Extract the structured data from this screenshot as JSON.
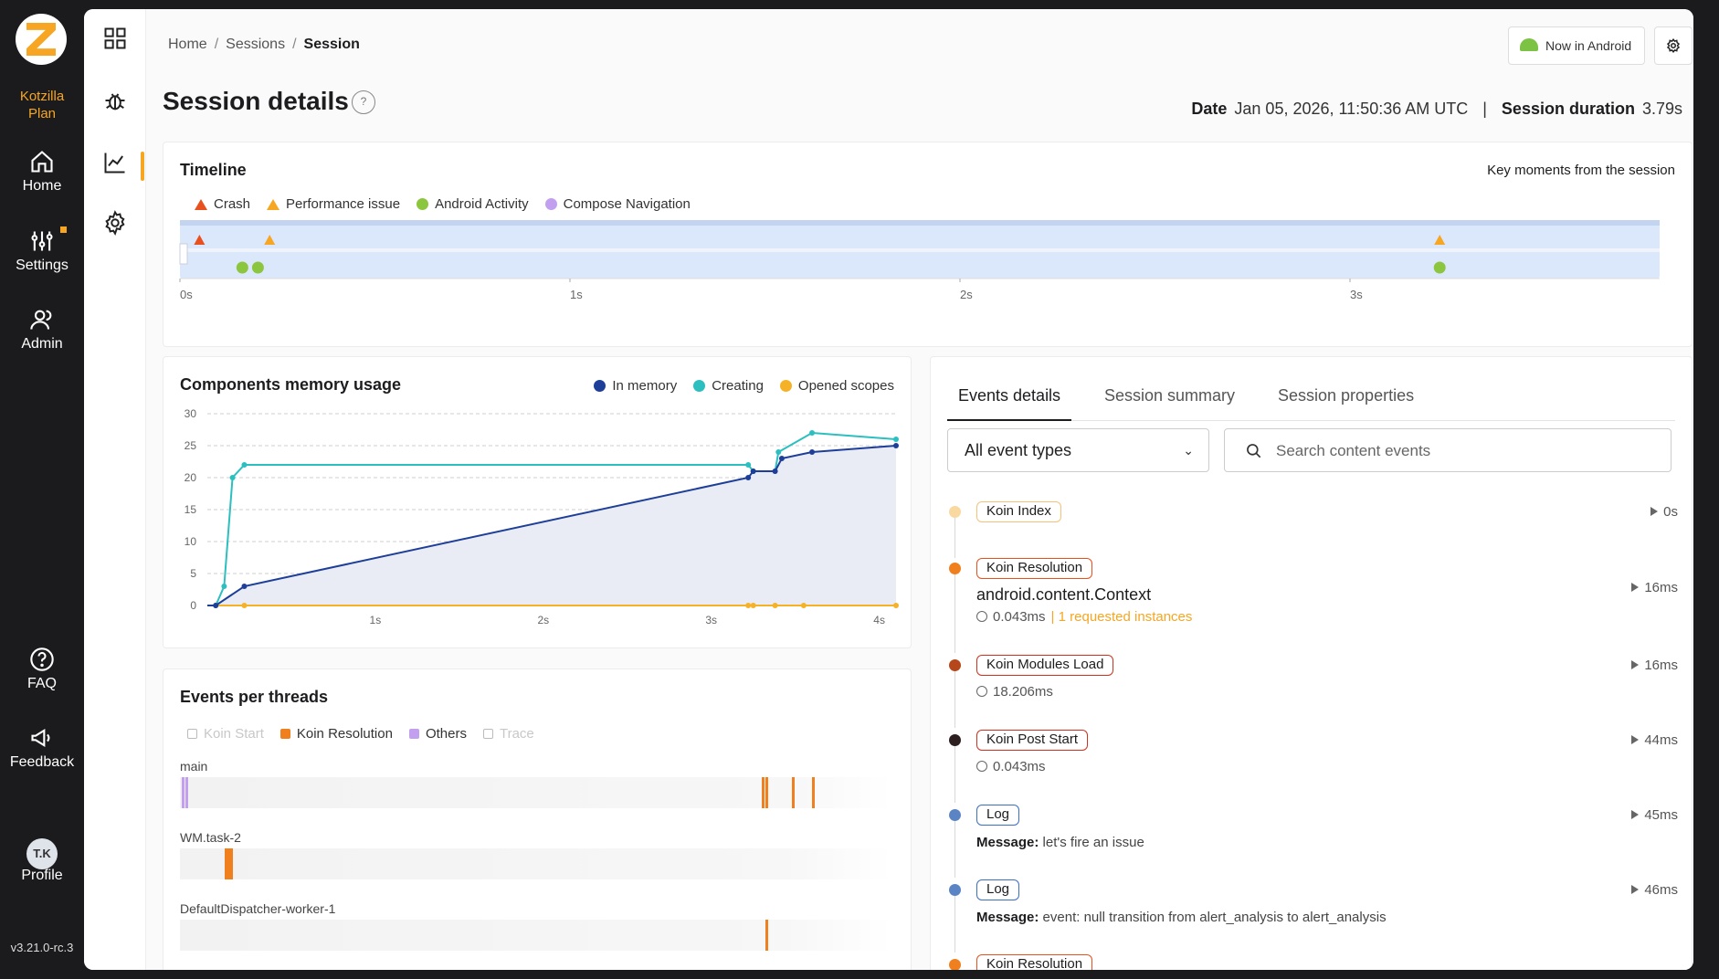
{
  "sidebar": {
    "plan_line1": "Kotzilla",
    "plan_line2": "Plan",
    "nav": [
      {
        "label": "Home"
      },
      {
        "label": "Settings"
      },
      {
        "label": "Admin"
      },
      {
        "label": "FAQ"
      },
      {
        "label": "Feedback"
      },
      {
        "label": "Profile"
      }
    ],
    "avatar_initials": "T.K",
    "version": "v3.21.0-rc.3"
  },
  "header": {
    "breadcrumb": [
      "Home",
      "Sessions",
      "Session"
    ],
    "title": "Session details",
    "help_label": "?",
    "date_label": "Date",
    "date_value": "Jan 05, 2026, 11:50:36 AM UTC",
    "separator": "|",
    "duration_label": "Session duration",
    "duration_value": "3.79s",
    "app_button": "Now in Android"
  },
  "timeline": {
    "title": "Timeline",
    "note": "Key moments from the session",
    "legend": [
      {
        "label": "Crash",
        "color": "#e8501e",
        "shape": "triangle"
      },
      {
        "label": "Performance issue",
        "color": "#f6a623",
        "shape": "triangle"
      },
      {
        "label": "Android Activity",
        "color": "#8cc63f",
        "shape": "circle"
      },
      {
        "label": "Compose Navigation",
        "color": "#c39ff0",
        "shape": "circle"
      }
    ],
    "axis": [
      "0s",
      "1s",
      "2s",
      "3s"
    ],
    "markers": [
      {
        "kind": "Crash",
        "t": 0.05
      },
      {
        "kind": "Performance issue",
        "t": 0.23
      },
      {
        "kind": "Performance issue",
        "t": 3.23
      },
      {
        "kind": "Android Activity",
        "t": 0.16
      },
      {
        "kind": "Android Activity",
        "t": 0.2
      },
      {
        "kind": "Android Activity",
        "t": 3.23
      }
    ],
    "duration": 3.79
  },
  "memory": {
    "title": "Components memory usage",
    "legend": [
      {
        "label": "In memory",
        "color": "#1e3f99"
      },
      {
        "label": "Creating",
        "color": "#2bbfbf"
      },
      {
        "label": "Opened scopes",
        "color": "#f6b226"
      }
    ]
  },
  "chart_data": {
    "type": "line",
    "title": "Components memory usage",
    "xlabel": "",
    "ylabel": "",
    "xlim": [
      0,
      4.1
    ],
    "ylim": [
      0,
      30
    ],
    "x_ticks": [
      "1s",
      "2s",
      "3s",
      "4s"
    ],
    "y_ticks": [
      0,
      5,
      10,
      15,
      20,
      25,
      30
    ],
    "grid": true,
    "legend_position": "top-right",
    "series": [
      {
        "name": "In memory",
        "color": "#1e3f99",
        "area": true,
        "x": [
          0,
          0.05,
          0.22,
          3.22,
          3.25,
          3.38,
          3.42,
          3.6,
          4.1
        ],
        "y": [
          0,
          0,
          3,
          20,
          21,
          21,
          23,
          24,
          25
        ]
      },
      {
        "name": "Creating",
        "color": "#2bbfbf",
        "area": false,
        "x": [
          0,
          0.05,
          0.1,
          0.15,
          0.22,
          3.22,
          3.25,
          3.38,
          3.4,
          3.6,
          4.1
        ],
        "y": [
          0,
          0,
          3,
          20,
          22,
          22,
          21,
          21,
          24,
          27,
          26
        ]
      },
      {
        "name": "Opened scopes",
        "color": "#f6b226",
        "area": false,
        "x": [
          0,
          0.05,
          0.22,
          3.22,
          3.25,
          3.38,
          3.55,
          4.1
        ],
        "y": [
          0,
          0,
          0,
          0,
          0,
          0,
          0,
          0
        ]
      }
    ]
  },
  "threads": {
    "title": "Events per threads",
    "legend": [
      {
        "label": "Koin Start",
        "color": "#bbbbbb",
        "enabled": false
      },
      {
        "label": "Koin Resolution",
        "color": "#f07f1e",
        "enabled": true
      },
      {
        "label": "Others",
        "color": "#c39ff0",
        "enabled": true
      },
      {
        "label": "Trace",
        "color": "#bbbbbb",
        "enabled": false
      }
    ],
    "rows": [
      {
        "name": "main",
        "marks": [
          {
            "t": 0.01,
            "color": "#c39ff0"
          },
          {
            "t": 0.03,
            "color": "#c39ff0"
          },
          {
            "t": 3.35,
            "color": "#f07f1e"
          },
          {
            "t": 3.37,
            "color": "#f07f1e"
          },
          {
            "t": 3.52,
            "color": "#f07f1e"
          },
          {
            "t": 3.64,
            "color": "#f07f1e"
          }
        ]
      },
      {
        "name": "WM.task-2",
        "marks": [
          {
            "t": 0.26,
            "color": "#f07f1e"
          },
          {
            "t": 0.28,
            "color": "#f07f1e"
          }
        ]
      },
      {
        "name": "DefaultDispatcher-worker-1",
        "marks": [
          {
            "t": 3.37,
            "color": "#f07f1e"
          }
        ]
      }
    ],
    "duration": 4.1
  },
  "events": {
    "tabs": [
      "Events details",
      "Session summary",
      "Session properties"
    ],
    "filter": "All event types",
    "search_placeholder": "Search content events",
    "list": [
      {
        "tag": "Koin Index",
        "dot": "#f9d9a0",
        "border": "#f6c27a",
        "time": "0s"
      },
      {
        "tag": "Koin Resolution",
        "dot": "#f07f1e",
        "border": "#e8501e",
        "time": "16ms",
        "text": "android.content.Context",
        "duration": "0.043ms",
        "extra": "1 requested instances"
      },
      {
        "tag": "Koin Modules Load",
        "dot": "#b5471b",
        "border": "#d2301e",
        "time": "16ms",
        "duration": "18.206ms"
      },
      {
        "tag": "Koin Post Start",
        "dot": "#2d1f1f",
        "border": "#d2301e",
        "time": "44ms",
        "duration": "0.043ms"
      },
      {
        "tag": "Log",
        "dot": "#5b84c4",
        "border": "#3a6fc4",
        "time": "45ms",
        "msg_label": "Message:",
        "msg": "let's fire an issue"
      },
      {
        "tag": "Log",
        "dot": "#5b84c4",
        "border": "#3a6fc4",
        "time": "46ms",
        "msg_label": "Message:",
        "msg": "event: null transition from alert_analysis to alert_analysis"
      },
      {
        "tag": "Koin Resolution",
        "dot": "#f07f1e",
        "border": "#e8501e",
        "time": ""
      }
    ]
  }
}
